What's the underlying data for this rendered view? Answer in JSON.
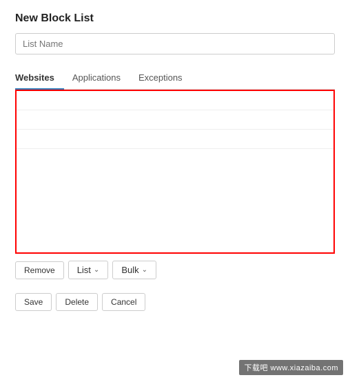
{
  "page": {
    "title": "New Block List",
    "list_name_placeholder": "List Name",
    "tabs": [
      {
        "label": "Websites",
        "active": true
      },
      {
        "label": "Applications",
        "active": false
      },
      {
        "label": "Exceptions",
        "active": false
      }
    ],
    "content_rows": 3,
    "action_buttons": {
      "remove": "Remove",
      "list": "List",
      "bulk": "Bulk"
    },
    "bottom_buttons": {
      "save": "Save",
      "delete": "Delete",
      "cancel": "Cancel"
    },
    "watermark": "下载吧 www.xiazaiba.com"
  }
}
